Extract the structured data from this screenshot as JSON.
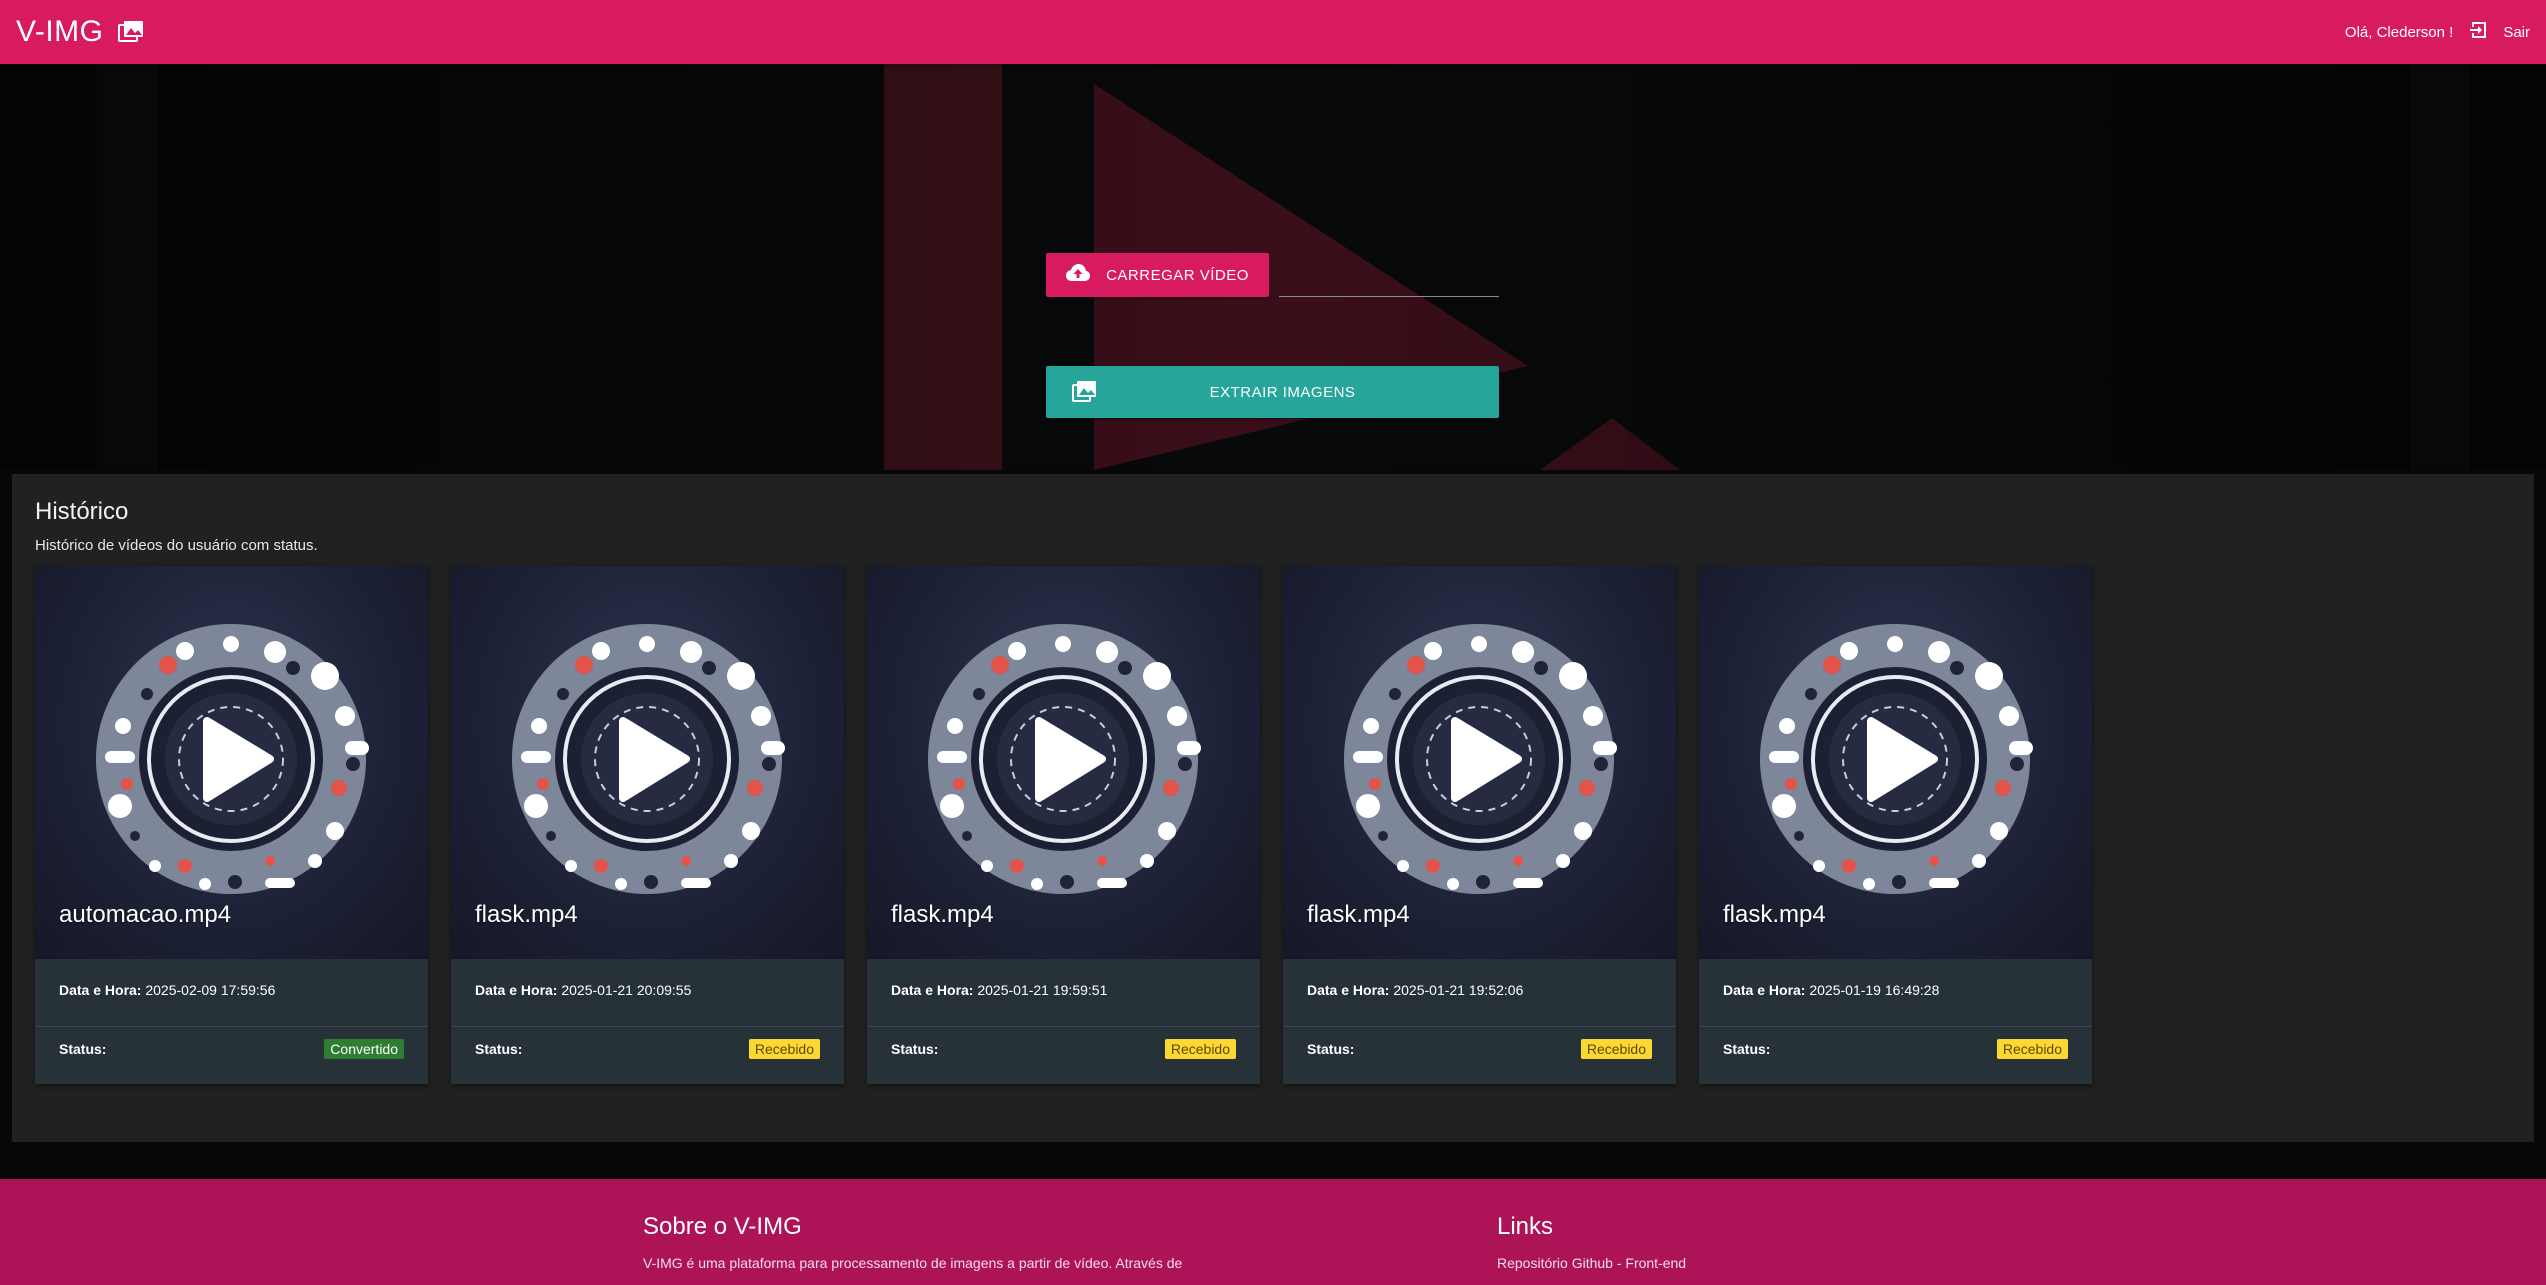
{
  "header": {
    "brand": "V-IMG",
    "brand_icon": "photo-library-icon",
    "greeting": "Olá, Clederson !",
    "logout_icon": "exit-to-app-icon",
    "logout_label": "Sair",
    "color": "#d81b60"
  },
  "hero": {
    "upload_label": "Carregar vídeo",
    "upload_icon": "cloud-upload-icon",
    "file_value": "",
    "extract_label": "Extrair imagens",
    "extract_icon": "photo-library-icon",
    "extract_color": "#26a69a"
  },
  "history": {
    "title": "Histórico",
    "subtitle": "Histórico de vídeos do usuário com status.",
    "date_label": "Data e Hora:",
    "status_label": "Status:",
    "items": [
      {
        "name": "automacao.mp4",
        "datetime": "2025-02-09 17:59:56",
        "status": "Convertido",
        "status_color": "#2e7d32"
      },
      {
        "name": "flask.mp4",
        "datetime": "2025-01-21 20:09:55",
        "status": "Recebido",
        "status_color": "#fdd835"
      },
      {
        "name": "flask.mp4",
        "datetime": "2025-01-21 19:59:51",
        "status": "Recebido",
        "status_color": "#fdd835"
      },
      {
        "name": "flask.mp4",
        "datetime": "2025-01-21 19:52:06",
        "status": "Recebido",
        "status_color": "#fdd835"
      },
      {
        "name": "flask.mp4",
        "datetime": "2025-01-19 16:49:28",
        "status": "Recebido",
        "status_color": "#fdd835"
      }
    ]
  },
  "footer": {
    "about_title": "Sobre o V-IMG",
    "about_text": "V-IMG é uma plataforma para processamento de imagens a partir de vídeo. Através de",
    "links_title": "Links",
    "links": [
      "Repositório Github - Front-end"
    ],
    "color": "#ad1457"
  }
}
